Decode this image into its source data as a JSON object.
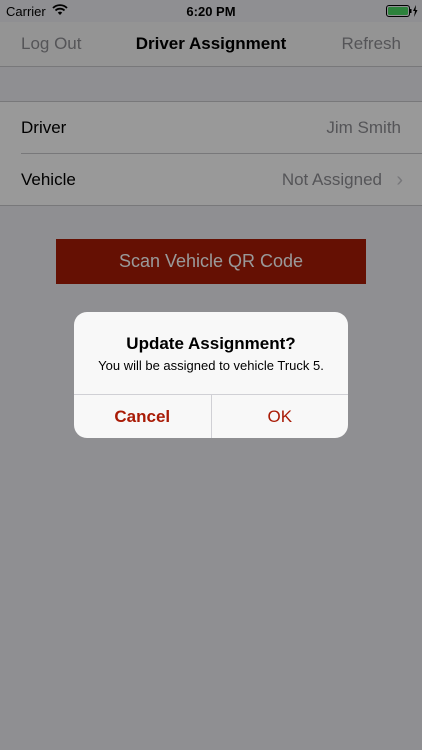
{
  "status_bar": {
    "carrier": "Carrier",
    "time": "6:20 PM",
    "battery_color": "#4cd964"
  },
  "nav": {
    "left_label": "Log Out",
    "title": "Driver Assignment",
    "right_label": "Refresh"
  },
  "assignment": {
    "rows": [
      {
        "label": "Driver",
        "value": "Jim Smith"
      },
      {
        "label": "Vehicle",
        "value": "Not Assigned"
      }
    ]
  },
  "scan_button": {
    "label": "Scan Vehicle QR Code"
  },
  "alert": {
    "title": "Update Assignment?",
    "message": "You will be assigned to vehicle Truck 5.",
    "cancel_label": "Cancel",
    "ok_label": "OK"
  },
  "colors": {
    "accent": "#a91b06",
    "secondary_text": "#8e8e93"
  },
  "icons": [
    "wifi-icon",
    "battery-icon",
    "charging-bolt-icon",
    "chevron-right-icon"
  ]
}
